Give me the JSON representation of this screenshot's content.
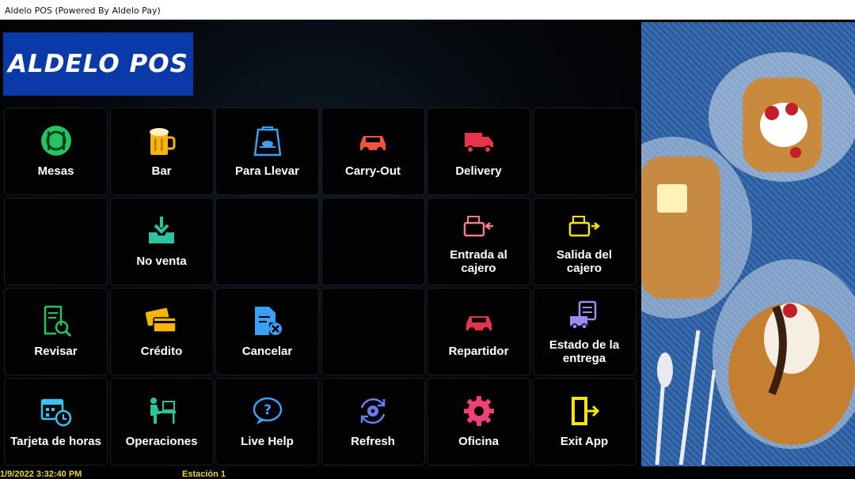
{
  "window": {
    "title": "Aldelo POS (Powered By Aldelo Pay)"
  },
  "logo": {
    "text": "ALDELO POS"
  },
  "tiles": [
    {
      "label": "Mesas",
      "icon": "dining-icon",
      "color": "#22c55e"
    },
    {
      "label": "Bar",
      "icon": "beer-mug-icon",
      "color": "#f5b50a"
    },
    {
      "label": "Para Llevar",
      "icon": "takeout-bag-icon",
      "color": "#3b9ff5"
    },
    {
      "label": "Carry-Out",
      "icon": "car-icon",
      "color": "#f0533d"
    },
    {
      "label": "Delivery",
      "icon": "delivery-truck-icon",
      "color": "#e8344a"
    },
    {
      "label": "",
      "icon": "",
      "color": ""
    },
    {
      "label": "",
      "icon": "",
      "color": ""
    },
    {
      "label": "No venta",
      "icon": "drawer-icon",
      "color": "#2cc3a0"
    },
    {
      "label": "",
      "icon": "",
      "color": ""
    },
    {
      "label": "",
      "icon": "",
      "color": ""
    },
    {
      "label": "Entrada al\ncajero",
      "icon": "cash-register-in-icon",
      "color": "#f07c8e"
    },
    {
      "label": "Salida del\ncajero",
      "icon": "cash-register-out-icon",
      "color": "#f5e60a"
    },
    {
      "label": "Revisar",
      "icon": "review-receipt-icon",
      "color": "#22c55e"
    },
    {
      "label": "Crédito",
      "icon": "credit-cards-icon",
      "color": "#f5b50a"
    },
    {
      "label": "Cancelar",
      "icon": "cancel-document-icon",
      "color": "#3b9ff5"
    },
    {
      "label": "",
      "icon": "",
      "color": ""
    },
    {
      "label": "Repartidor",
      "icon": "driver-car-icon",
      "color": "#e8344a"
    },
    {
      "label": "Estado de la\nentrega",
      "icon": "delivery-status-icon",
      "color": "#9b8cf0"
    },
    {
      "label": "Tarjeta de horas",
      "icon": "timecard-icon",
      "color": "#3bc3f5"
    },
    {
      "label": "Operaciones",
      "icon": "operations-icon",
      "color": "#2cc39a"
    },
    {
      "label": "Live Help",
      "icon": "help-bubble-icon",
      "color": "#3b9ff5"
    },
    {
      "label": "Refresh",
      "icon": "refresh-gear-icon",
      "color": "#6a7cf0"
    },
    {
      "label": "Oficina",
      "icon": "settings-gear-icon",
      "color": "#f0407a"
    },
    {
      "label": "Exit App",
      "icon": "exit-door-icon",
      "color": "#f5e60a"
    }
  ],
  "status": {
    "datetime": "1/9/2022 3:32:40 PM",
    "station": "Estación 1"
  }
}
